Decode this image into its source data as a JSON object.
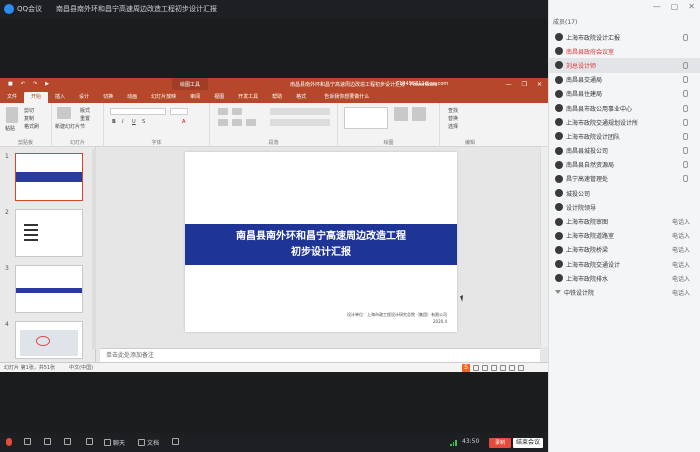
{
  "meeting": {
    "title_app": "QQ会议",
    "title_subject": "南昌县南外环和昌宁高速周边改造工程初步设计汇报",
    "window_controls": [
      "minimize",
      "maximize",
      "close"
    ]
  },
  "ppt": {
    "title_quick": [
      "save",
      "undo",
      "redo",
      "start"
    ],
    "context_tab": "绘图工具",
    "filename": "南昌县南外环和昌宁高速周边改造工程初步设计汇报 - PowerPoint",
    "user": "614493811@qq.com",
    "tabs": [
      "文件",
      "开始",
      "插入",
      "设计",
      "切换",
      "动画",
      "幻灯片放映",
      "审阅",
      "视图",
      "开发工具",
      "帮助",
      "格式"
    ],
    "active_tab": "开始",
    "tell_me": "告诉我你想要做什么",
    "ribbon_groups": [
      {
        "label": "剪贴板"
      },
      {
        "label": "幻灯片"
      },
      {
        "label": "字体"
      },
      {
        "label": "段落"
      },
      {
        "label": "绘图"
      },
      {
        "label": "编辑"
      }
    ],
    "ribbon_items": {
      "paste": "粘贴",
      "cut": "剪切",
      "copy": "复制",
      "format_painter": "格式刷",
      "new_slide": "新建幻灯片",
      "layout": "版式",
      "reset": "重置",
      "section": "节",
      "find": "查找",
      "replace": "替换",
      "select": "选择"
    },
    "thumbnails": [
      "1",
      "2",
      "3",
      "4"
    ],
    "slide": {
      "title_line1": "南昌县南外环和昌宁高速周边改造工程",
      "title_line2": "初步设计汇报",
      "footer_line1": "设计单位：上海市政工程设计研究总院（集团）有限公司",
      "footer_line2": "2020.4"
    },
    "notes_placeholder": "单击此处添加备注",
    "status_slide": "幻灯片 第1张，共51张",
    "status_lang": "中文(中国)",
    "ime_logo": "S"
  },
  "participants": {
    "header": "成员(17)",
    "items": [
      {
        "name": "上海市政院设计汇报",
        "status": "",
        "color": "normal"
      },
      {
        "name": "南昌县政府会议室",
        "status": "",
        "color": "red"
      },
      {
        "name": "刘总设计师",
        "status": "",
        "color": "red",
        "selected": true
      },
      {
        "name": "南昌县交通局",
        "status": "",
        "color": "normal"
      },
      {
        "name": "南昌县住建局",
        "status": "",
        "color": "normal"
      },
      {
        "name": "南昌县市政公用事业中心",
        "status": "",
        "color": "normal"
      },
      {
        "name": "上海市政院交通规划设计所",
        "status": "",
        "color": "normal"
      },
      {
        "name": "上海市政院设计团队",
        "status": "",
        "color": "normal"
      },
      {
        "name": "南昌县城投公司",
        "status": "",
        "color": "normal"
      },
      {
        "name": "南昌县自然资源局",
        "status": "",
        "color": "normal"
      },
      {
        "name": "昌宁高速管理处",
        "status": "",
        "color": "normal"
      },
      {
        "name": "城投公司",
        "status": "",
        "color": "normal"
      },
      {
        "name": "设计院领导",
        "status": "",
        "color": "normal"
      },
      {
        "name": "上海市政院审图",
        "status": "电话入",
        "color": "normal"
      },
      {
        "name": "上海市政院道路室",
        "status": "电话入",
        "color": "normal"
      },
      {
        "name": "上海市政院桥梁",
        "status": "电话入",
        "color": "normal"
      },
      {
        "name": "上海市政院交通设计",
        "status": "电话入",
        "color": "normal"
      },
      {
        "name": "上海市政院排水",
        "status": "电话入",
        "color": "normal"
      },
      {
        "name": "中铁设计院",
        "status": "电话入",
        "color": "normal"
      }
    ]
  },
  "bottombar": {
    "mute": "静音",
    "video": "开启视频",
    "share": "共享屏幕",
    "members": "管理成员",
    "chat": "聊天",
    "manage": "设置",
    "doc": "文档",
    "record": "录制",
    "duration": "43:50",
    "rec_btn": "录制",
    "end_btn": "结束会议"
  },
  "colors": {
    "ppt_accent": "#b7472a",
    "slide_band": "#1f3595",
    "record_red": "#e64a3a"
  }
}
